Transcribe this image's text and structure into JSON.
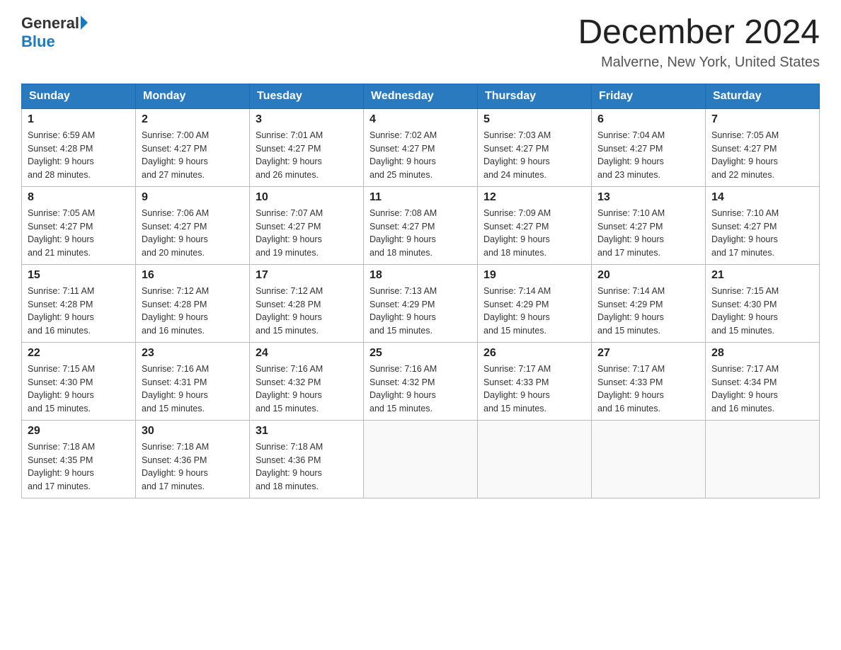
{
  "header": {
    "logo_general": "General",
    "logo_blue": "Blue",
    "month_title": "December 2024",
    "location": "Malverne, New York, United States"
  },
  "days_of_week": [
    "Sunday",
    "Monday",
    "Tuesday",
    "Wednesday",
    "Thursday",
    "Friday",
    "Saturday"
  ],
  "weeks": [
    [
      {
        "day": "1",
        "sunrise": "6:59 AM",
        "sunset": "4:28 PM",
        "daylight": "9 hours and 28 minutes."
      },
      {
        "day": "2",
        "sunrise": "7:00 AM",
        "sunset": "4:27 PM",
        "daylight": "9 hours and 27 minutes."
      },
      {
        "day": "3",
        "sunrise": "7:01 AM",
        "sunset": "4:27 PM",
        "daylight": "9 hours and 26 minutes."
      },
      {
        "day": "4",
        "sunrise": "7:02 AM",
        "sunset": "4:27 PM",
        "daylight": "9 hours and 25 minutes."
      },
      {
        "day": "5",
        "sunrise": "7:03 AM",
        "sunset": "4:27 PM",
        "daylight": "9 hours and 24 minutes."
      },
      {
        "day": "6",
        "sunrise": "7:04 AM",
        "sunset": "4:27 PM",
        "daylight": "9 hours and 23 minutes."
      },
      {
        "day": "7",
        "sunrise": "7:05 AM",
        "sunset": "4:27 PM",
        "daylight": "9 hours and 22 minutes."
      }
    ],
    [
      {
        "day": "8",
        "sunrise": "7:05 AM",
        "sunset": "4:27 PM",
        "daylight": "9 hours and 21 minutes."
      },
      {
        "day": "9",
        "sunrise": "7:06 AM",
        "sunset": "4:27 PM",
        "daylight": "9 hours and 20 minutes."
      },
      {
        "day": "10",
        "sunrise": "7:07 AM",
        "sunset": "4:27 PM",
        "daylight": "9 hours and 19 minutes."
      },
      {
        "day": "11",
        "sunrise": "7:08 AM",
        "sunset": "4:27 PM",
        "daylight": "9 hours and 18 minutes."
      },
      {
        "day": "12",
        "sunrise": "7:09 AM",
        "sunset": "4:27 PM",
        "daylight": "9 hours and 18 minutes."
      },
      {
        "day": "13",
        "sunrise": "7:10 AM",
        "sunset": "4:27 PM",
        "daylight": "9 hours and 17 minutes."
      },
      {
        "day": "14",
        "sunrise": "7:10 AM",
        "sunset": "4:27 PM",
        "daylight": "9 hours and 17 minutes."
      }
    ],
    [
      {
        "day": "15",
        "sunrise": "7:11 AM",
        "sunset": "4:28 PM",
        "daylight": "9 hours and 16 minutes."
      },
      {
        "day": "16",
        "sunrise": "7:12 AM",
        "sunset": "4:28 PM",
        "daylight": "9 hours and 16 minutes."
      },
      {
        "day": "17",
        "sunrise": "7:12 AM",
        "sunset": "4:28 PM",
        "daylight": "9 hours and 15 minutes."
      },
      {
        "day": "18",
        "sunrise": "7:13 AM",
        "sunset": "4:29 PM",
        "daylight": "9 hours and 15 minutes."
      },
      {
        "day": "19",
        "sunrise": "7:14 AM",
        "sunset": "4:29 PM",
        "daylight": "9 hours and 15 minutes."
      },
      {
        "day": "20",
        "sunrise": "7:14 AM",
        "sunset": "4:29 PM",
        "daylight": "9 hours and 15 minutes."
      },
      {
        "day": "21",
        "sunrise": "7:15 AM",
        "sunset": "4:30 PM",
        "daylight": "9 hours and 15 minutes."
      }
    ],
    [
      {
        "day": "22",
        "sunrise": "7:15 AM",
        "sunset": "4:30 PM",
        "daylight": "9 hours and 15 minutes."
      },
      {
        "day": "23",
        "sunrise": "7:16 AM",
        "sunset": "4:31 PM",
        "daylight": "9 hours and 15 minutes."
      },
      {
        "day": "24",
        "sunrise": "7:16 AM",
        "sunset": "4:32 PM",
        "daylight": "9 hours and 15 minutes."
      },
      {
        "day": "25",
        "sunrise": "7:16 AM",
        "sunset": "4:32 PM",
        "daylight": "9 hours and 15 minutes."
      },
      {
        "day": "26",
        "sunrise": "7:17 AM",
        "sunset": "4:33 PM",
        "daylight": "9 hours and 15 minutes."
      },
      {
        "day": "27",
        "sunrise": "7:17 AM",
        "sunset": "4:33 PM",
        "daylight": "9 hours and 16 minutes."
      },
      {
        "day": "28",
        "sunrise": "7:17 AM",
        "sunset": "4:34 PM",
        "daylight": "9 hours and 16 minutes."
      }
    ],
    [
      {
        "day": "29",
        "sunrise": "7:18 AM",
        "sunset": "4:35 PM",
        "daylight": "9 hours and 17 minutes."
      },
      {
        "day": "30",
        "sunrise": "7:18 AM",
        "sunset": "4:36 PM",
        "daylight": "9 hours and 17 minutes."
      },
      {
        "day": "31",
        "sunrise": "7:18 AM",
        "sunset": "4:36 PM",
        "daylight": "9 hours and 18 minutes."
      },
      null,
      null,
      null,
      null
    ]
  ],
  "labels": {
    "sunrise": "Sunrise:",
    "sunset": "Sunset:",
    "daylight": "Daylight: 9 hours"
  }
}
